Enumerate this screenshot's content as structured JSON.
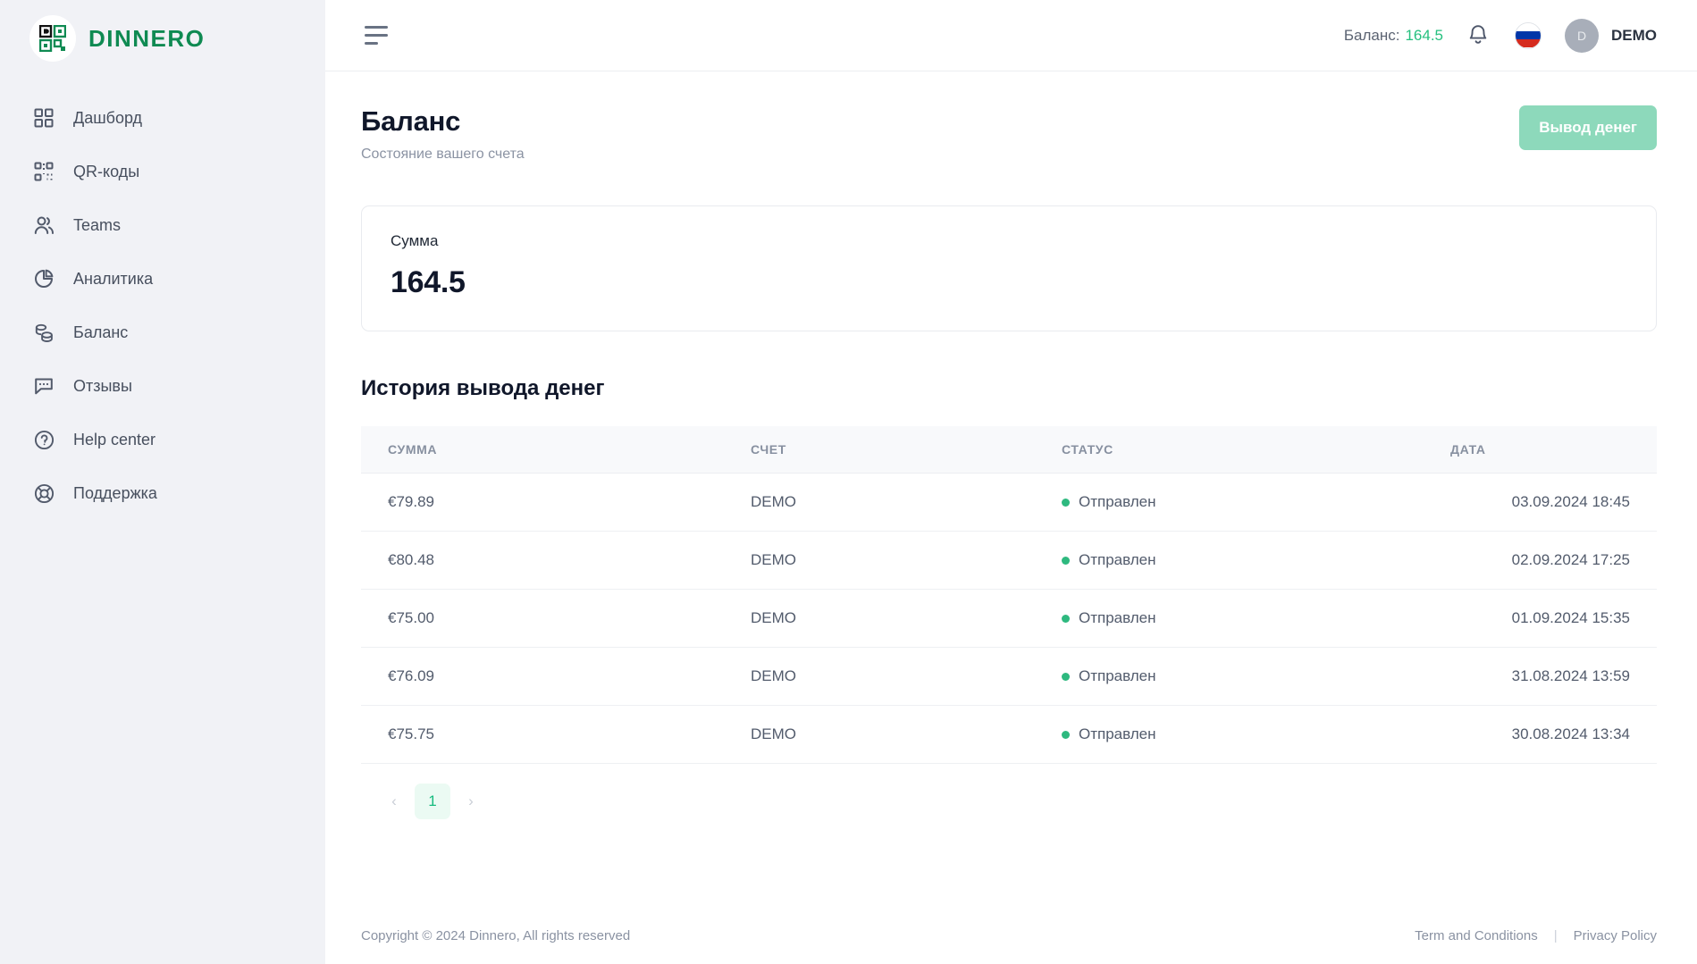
{
  "brand": {
    "name": "DINNERO",
    "logo_icon": "qr-code-logo-icon",
    "accent": "#0f8a52"
  },
  "sidebar": {
    "items": [
      {
        "label": "Дашборд",
        "icon": "grid-dashboard-icon"
      },
      {
        "label": "QR-коды",
        "icon": "qr-code-icon"
      },
      {
        "label": "Teams",
        "icon": "users-icon"
      },
      {
        "label": "Аналитика",
        "icon": "pie-chart-icon"
      },
      {
        "label": "Баланс",
        "icon": "coins-icon"
      },
      {
        "label": "Отзывы",
        "icon": "chat-bubble-icon"
      },
      {
        "label": "Help center",
        "icon": "question-circle-icon"
      },
      {
        "label": "Поддержка",
        "icon": "lifebuoy-icon"
      }
    ]
  },
  "topbar": {
    "menu_icon": "hamburger-icon",
    "balance_label": "Баланс:",
    "balance_value": "164.5",
    "balance_color": "#26c07f",
    "bell_icon": "bell-icon",
    "flag_icon": "russia-flag-icon",
    "avatar_initial": "D",
    "user_name": "DEMO"
  },
  "page": {
    "title": "Баланс",
    "subtitle": "Состояние вашего счета",
    "withdraw_button": "Вывод денег",
    "withdraw_button_color": "#8dd9bb"
  },
  "amount_card": {
    "label": "Сумма",
    "value": "164.5"
  },
  "history": {
    "title": "История вывода денег",
    "columns": [
      "СУММА",
      "СЧЕТ",
      "СТАТУС",
      "ДАТА"
    ],
    "status_color": "#2eb97f",
    "rows": [
      {
        "amount": "€79.89",
        "account": "DEMO",
        "status": "Отправлен",
        "date": "03.09.2024 18:45"
      },
      {
        "amount": "€80.48",
        "account": "DEMO",
        "status": "Отправлен",
        "date": "02.09.2024 17:25"
      },
      {
        "amount": "€75.00",
        "account": "DEMO",
        "status": "Отправлен",
        "date": "01.09.2024 15:35"
      },
      {
        "amount": "€76.09",
        "account": "DEMO",
        "status": "Отправлен",
        "date": "31.08.2024 13:59"
      },
      {
        "amount": "€75.75",
        "account": "DEMO",
        "status": "Отправлен",
        "date": "30.08.2024 13:34"
      }
    ]
  },
  "pagination": {
    "prev_icon": "chevron-left-icon",
    "next_icon": "chevron-right-icon",
    "current_page": "1",
    "active_color": "#17bb7f"
  },
  "footer": {
    "copyright": "Copyright © 2024 Dinnero, All rights reserved",
    "terms": "Term and Conditions",
    "separator": "|",
    "privacy": "Privacy Policy"
  }
}
